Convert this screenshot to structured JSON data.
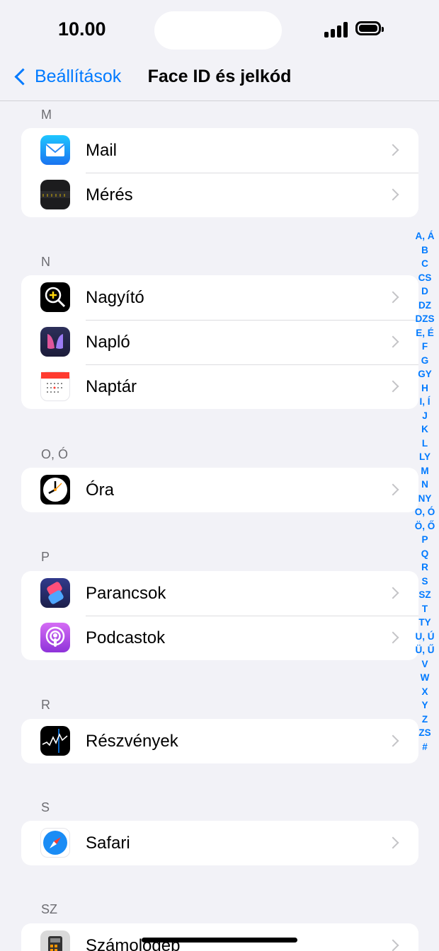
{
  "status": {
    "time": "10.00"
  },
  "nav": {
    "back_label": "Beállítások",
    "title": "Face ID és jelkód"
  },
  "sections": [
    {
      "header": "M",
      "items": [
        {
          "label": "Mail",
          "icon": "mail-icon"
        },
        {
          "label": "Mérés",
          "icon": "measure-icon"
        }
      ]
    },
    {
      "header": "N",
      "items": [
        {
          "label": "Nagyító",
          "icon": "magnifier-icon"
        },
        {
          "label": "Napló",
          "icon": "journal-icon"
        },
        {
          "label": "Naptár",
          "icon": "calendar-icon"
        }
      ]
    },
    {
      "header": "O, Ó",
      "items": [
        {
          "label": "Óra",
          "icon": "clock-icon"
        }
      ]
    },
    {
      "header": "P",
      "items": [
        {
          "label": "Parancsok",
          "icon": "shortcuts-icon"
        },
        {
          "label": "Podcastok",
          "icon": "podcasts-icon"
        }
      ]
    },
    {
      "header": "R",
      "items": [
        {
          "label": "Részvények",
          "icon": "stocks-icon"
        }
      ]
    },
    {
      "header": "S",
      "items": [
        {
          "label": "Safari",
          "icon": "safari-icon"
        }
      ]
    },
    {
      "header": "SZ",
      "items": [
        {
          "label": "Számológép",
          "icon": "calculator-icon"
        }
      ]
    }
  ],
  "index": [
    "A, Á",
    "B",
    "C",
    "CS",
    "D",
    "DZ",
    "DZS",
    "E, É",
    "F",
    "G",
    "GY",
    "H",
    "I, Í",
    "J",
    "K",
    "L",
    "LY",
    "M",
    "N",
    "NY",
    "O, Ó",
    "Ö, Ő",
    "P",
    "Q",
    "R",
    "S",
    "SZ",
    "T",
    "TY",
    "U, Ú",
    "Ü, Ű",
    "V",
    "W",
    "X",
    "Y",
    "Z",
    "ZS",
    "#"
  ],
  "colors": {
    "accent": "#007aff",
    "background": "#f2f2f7"
  }
}
